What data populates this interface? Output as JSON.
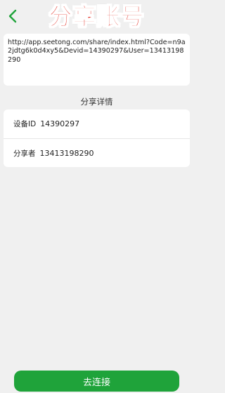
{
  "header": {
    "title": "分享账号",
    "back_icon": "chevron-left-icon"
  },
  "share_url": "http://app.seetong.com/share/index.html?Code=n9a2jdtg6k0d4xy5&Devid=14390297&User=13413198290",
  "details": {
    "section_title": "分享详情",
    "device_label": "设备ID",
    "device_value": "14390297",
    "sharer_label": "分享者",
    "sharer_value": "13413198290"
  },
  "connect_button": {
    "label": "去连接"
  },
  "colors": {
    "accent": "#1fa33a",
    "title": "#e3342a",
    "background": "#f0f0f0"
  }
}
